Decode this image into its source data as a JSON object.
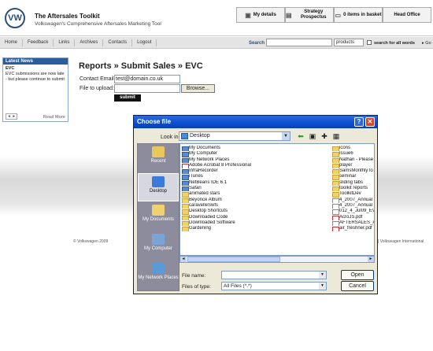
{
  "header": {
    "logo": "VW",
    "title": "The Aftersales Toolkit",
    "subtitle": "Volkswagen's Comprehensive Aftersales Marketing Tool",
    "my_details": "My details",
    "strategy": "Strategy Prospectus",
    "basket": "0 items in basket",
    "head_office": "Head Office"
  },
  "nav": [
    "Home",
    "Feedback",
    "Links",
    "Archives",
    "Contacts",
    "Logout"
  ],
  "search": {
    "label": "Search",
    "select": "products",
    "all_words": "search for all words",
    "go": "Go"
  },
  "news": {
    "title": "Latest News",
    "item_title": "EVC",
    "item_body": "EVC submissions are now late - but please continue to submit",
    "pager": "◄ ►",
    "read_more": "Read More"
  },
  "main": {
    "breadcrumb": "Reports » Submit Sales » EVC",
    "contact_label": "Contact Email:",
    "contact_value": "test@domain.co.uk",
    "file_label": "File to upload:",
    "browse": "Browse...",
    "submit": "submit"
  },
  "footer": {
    "left": "© Volkswagen 2009",
    "right": "| Volkswagen International"
  },
  "dialog": {
    "title": "Choose file",
    "look_in_label": "Look in:",
    "look_in_value": "Desktop",
    "places": [
      "Recent",
      "Desktop",
      "My Documents",
      "My Computer",
      "My Network Places"
    ],
    "col1": [
      "My Documents",
      "My Computer",
      "My Network Places",
      "Adobe Acrobat 8 Professional",
      "InfraRecorder",
      "iTunes",
      "NetBeans IDE 6.1",
      "Safari",
      "animated stars",
      "Beyonce Album",
      "caravelleSwfs",
      "Desktop Shortcuts",
      "Downloaded Code",
      "Downloaded Software",
      "Gardening"
    ],
    "col2": [
      "icons",
      "Issue6",
      "Nathan - Please",
      "player",
      "SamsMonthlyTo",
      "seminar",
      "sliding tabs",
      "toolkit reports",
      "ToolkitDev",
      "4_2007_Annual",
      "4_2007_Annual",
      "012_4_Jul09_EV",
      "AcroJS.pdf",
      "AFTERSALES_A",
      "air_freshner.pdf"
    ],
    "file_name_label": "File name:",
    "file_type_label": "Files of type:",
    "file_type_value": "All Files (*.*)",
    "open": "Open",
    "cancel": "Cancel"
  }
}
